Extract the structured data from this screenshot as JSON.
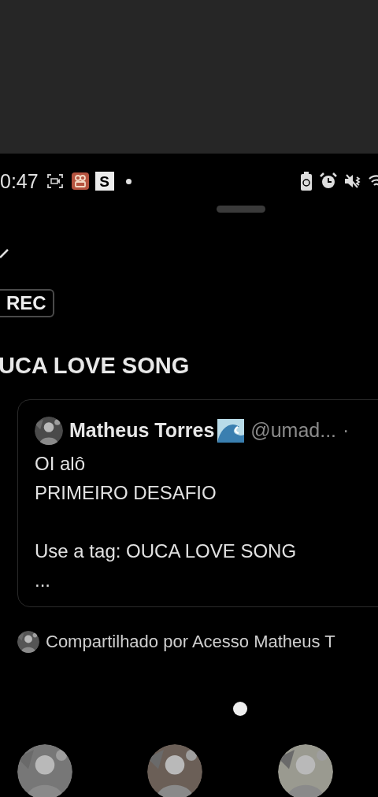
{
  "status_bar": {
    "time": "0:47",
    "app_badge": "S"
  },
  "badge": "REC",
  "title": "UCA LOVE SONG",
  "quoted_post": {
    "author": "Matheus Torres",
    "handle": "@umad...",
    "separator": "·",
    "paragraphs": [
      {
        "lines": [
          "OI alô",
          "PRIMEIRO DESAFIO"
        ]
      },
      {
        "lines": [
          "Use a tag: OUCA LOVE SONG",
          "..."
        ]
      }
    ]
  },
  "shared_by": "Compartilhado por Acesso Matheus T"
}
